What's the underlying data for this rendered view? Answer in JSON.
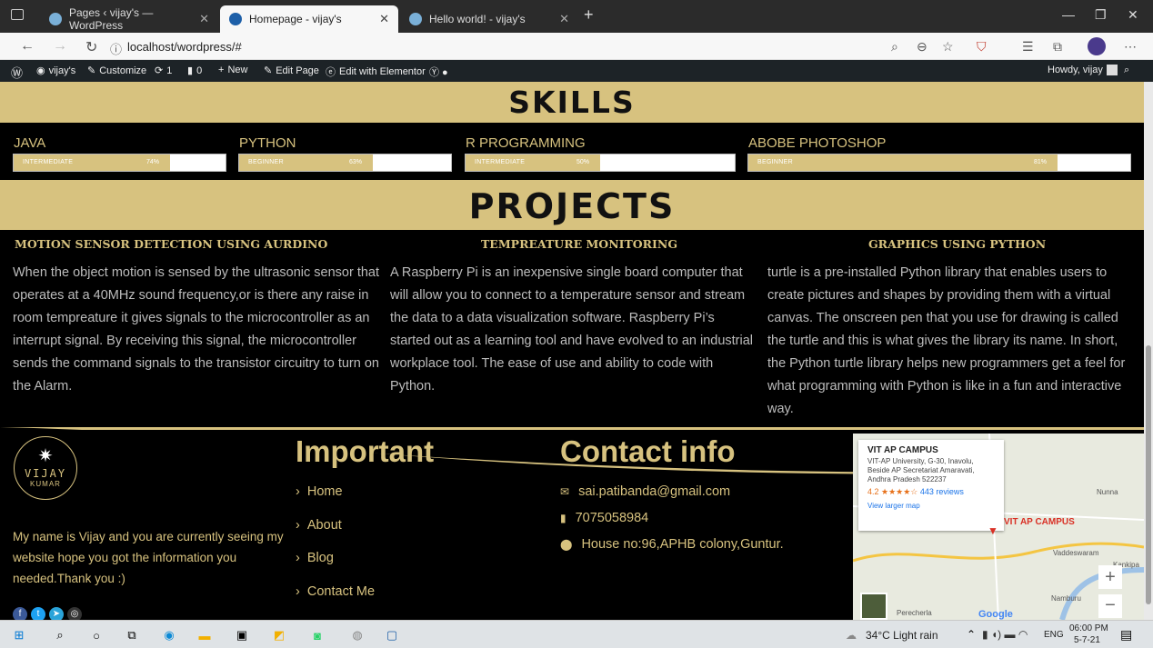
{
  "browser": {
    "tabs": [
      {
        "label": "Pages ‹ vijay's — WordPress",
        "active": false
      },
      {
        "label": "Homepage - vijay's",
        "active": true
      },
      {
        "label": "Hello world! - vijay's",
        "active": false
      }
    ],
    "url": "localhost/wordpress/#"
  },
  "wpbar": {
    "site": "vijay's",
    "customize": "Customize",
    "updates": "1",
    "comments": "0",
    "new": "New",
    "edit_page": "Edit Page",
    "elementor": "Edit with Elementor",
    "howdy": "Howdy, vijay"
  },
  "skills": {
    "heading": "SKILLS",
    "items": [
      {
        "name": "JAVA",
        "level": "INTERMEDIATE",
        "percent_label": "74%",
        "percent": 74
      },
      {
        "name": "PYTHON",
        "level": "BEGINNER",
        "percent_label": "63%",
        "percent": 63
      },
      {
        "name": "R PROGRAMMING",
        "level": "INTERMEDIATE",
        "percent_label": "50%",
        "percent": 50
      },
      {
        "name": "ABOBE PHOTOSHOP",
        "level": "BEGINNER",
        "percent_label": "81%",
        "percent": 81
      }
    ]
  },
  "projects": {
    "heading": "PROJECTS",
    "items": [
      {
        "title": "MOTION SENSOR DETECTION USING AURDINO",
        "text": "When the object motion is sensed by the ultrasonic sensor that operates at a 40MHz sound frequency,or is there any raise in room tempreature it gives signals to the microcontroller as an interrupt signal. By receiving this signal, the microcontroller sends the command signals to the transistor circuitry to turn on the Alarm."
      },
      {
        "title": "TEMPREATURE MONITORING",
        "text": "A Raspberry Pi is an inexpensive single board computer that will allow you to connect to a temperature sensor and stream the data to a data visualization software. Raspberry Pi’s started out as a learning tool and have evolved to an industrial workplace tool. The ease of use and ability to code with Python."
      },
      {
        "title": "GRAPHICS USING PYTHON",
        "text": "turtle is a pre-installed Python library that enables users to create pictures and shapes by providing them with a virtual canvas. The onscreen pen that you use for drawing is called the turtle and this is what gives the library its name. In short, the Python turtle library helps new programmers get a feel for what programming with Python is like in a fun and interactive way."
      }
    ]
  },
  "footer": {
    "logo_line1": "VIJAY",
    "logo_line2": "KUMAR",
    "about": "My name is Vijay and you are currently seeing my website hope you got the information you needed.Thank you :)",
    "important_heading": "Important",
    "links": [
      "Home",
      "About",
      "Blog",
      "Contact Me"
    ],
    "contact_heading": "Contact info",
    "email": "sai.patibanda@gmail.com",
    "phone": "7075058984",
    "address": "House no:96,APHB colony,Guntur."
  },
  "map": {
    "title": "VIT AP CAMPUS",
    "address": "VIT-AP University, G-30, Inavolu, Beside AP Secretariat Amaravati, Andhra Pradesh 522237",
    "rating": "4.2",
    "reviews": "443 reviews",
    "larger": "View larger map",
    "marker_label": "VIT AP CAMPUS",
    "places": [
      "Vaddeswaram",
      "Nunna",
      "Namburu",
      "Perecherla",
      "Kankipa"
    ]
  },
  "taskbar": {
    "weather": "34°C  Light rain",
    "lang": "ENG",
    "time": "06:00 PM",
    "date": "5-7-21"
  },
  "colors": {
    "gold": "#d7c27f",
    "wpbar": "#1d2327"
  }
}
